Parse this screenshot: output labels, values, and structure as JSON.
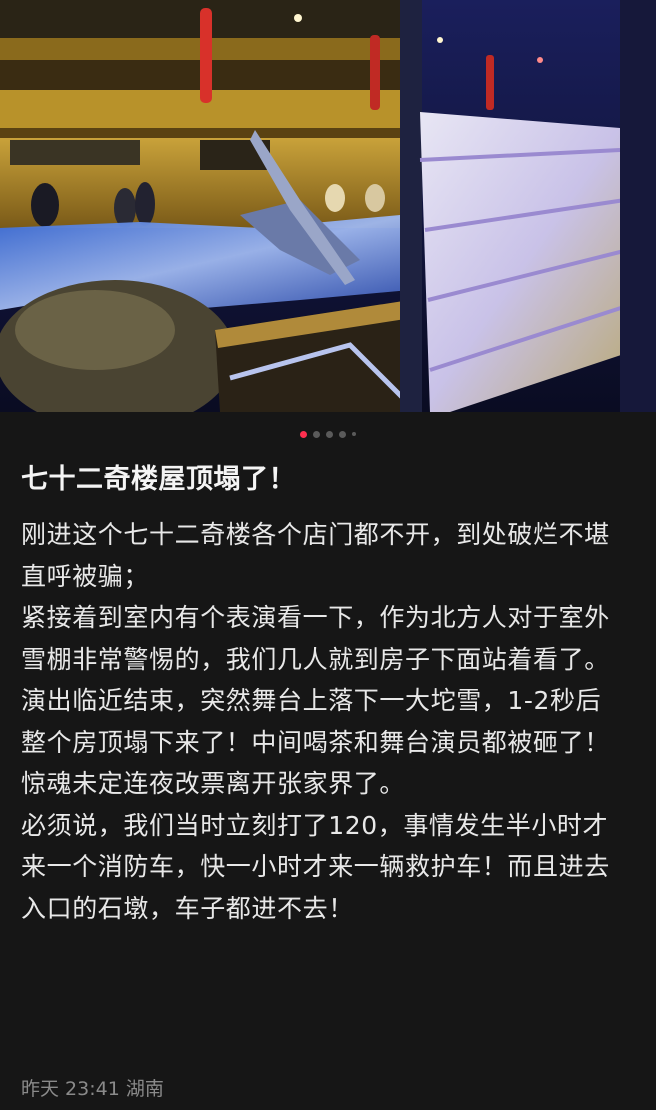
{
  "post": {
    "title": "七十二奇楼屋顶塌了！",
    "paragraphs": [
      "刚进这个七十二奇楼各个店门都不开，到处破烂不堪直呼被骗；",
      "紧接着到室内有个表演看一下，作为北方人对于室外雪棚非常警惕的，我们几人就到房子下面站着看了。",
      "演出临近结束，突然舞台上落下一大坨雪，1-2秒后整个房顶塌下来了！中间喝茶和舞台演员都被砸了！",
      "惊魂未定连夜改票离开张家界了。",
      "必须说，我们当时立刻打了120，事情发生半小时才来一个消防车，快一小时才来一辆救护车！而且进去入口的石墩，车子都进不去！"
    ],
    "time": "昨天 23:41",
    "location": "湖南"
  },
  "carousel": {
    "active_index": 0,
    "dot_count": 5,
    "active_color": "#ff2f4f"
  }
}
